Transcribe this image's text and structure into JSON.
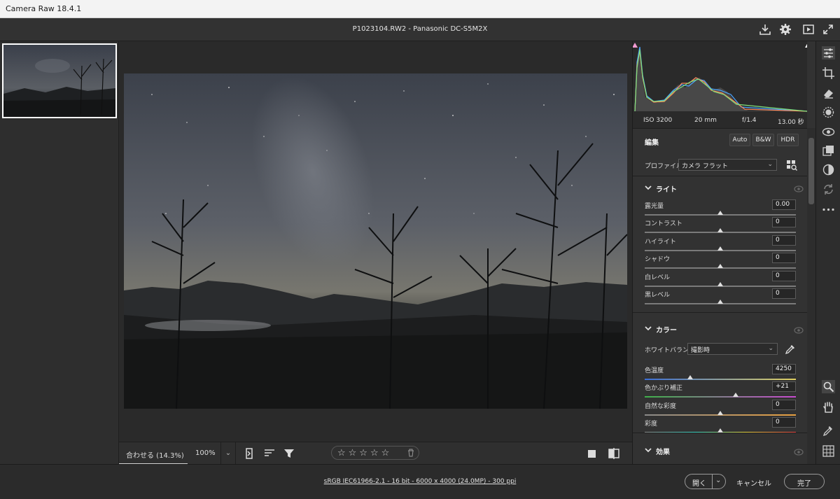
{
  "window": {
    "title": "Camera Raw 18.4.1"
  },
  "header": {
    "file_info": "P1023104.RW2  -  Panasonic DC-S5M2X"
  },
  "histogram": {
    "iso": "ISO 3200",
    "focal": "20 mm",
    "aperture": "f/1.4",
    "shutter": "13.00 秒"
  },
  "edit": {
    "title": "編集",
    "buttons": [
      "Auto",
      "B&W",
      "HDR"
    ],
    "profile_label": "プロファイル",
    "profile_value": "カメラ フラット"
  },
  "light": {
    "title": "ライト",
    "sliders": [
      {
        "name": "露光量",
        "value": "0.00",
        "pos": 0.5
      },
      {
        "name": "コントラスト",
        "value": "0",
        "pos": 0.5
      },
      {
        "name": "ハイライト",
        "value": "0",
        "pos": 0.5
      },
      {
        "name": "シャドウ",
        "value": "0",
        "pos": 0.5
      },
      {
        "name": "白レベル",
        "value": "0",
        "pos": 0.5
      },
      {
        "name": "黒レベル",
        "value": "0",
        "pos": 0.5
      }
    ]
  },
  "color": {
    "title": "カラー",
    "wb_label": "ホワイトバランス",
    "wb_value": "撮影時",
    "sliders": [
      {
        "name": "色温度",
        "value": "4250",
        "pos": 0.3
      },
      {
        "name": "色かぶり補正",
        "value": "+21",
        "pos": 0.6
      },
      {
        "name": "自然な彩度",
        "value": "0",
        "pos": 0.5
      },
      {
        "name": "彩度",
        "value": "0",
        "pos": 0.5
      }
    ]
  },
  "effects": {
    "title": "効果"
  },
  "viewer_bar": {
    "fit_label": "合わせる (14.3%)",
    "zoom_label": "100%",
    "stars": "☆☆☆☆☆"
  },
  "status": {
    "info": "sRGB IEC61966-2.1 - 16 bit - 6000 x 4000 (24.0MP) - 300 ppi"
  },
  "footer": {
    "open_label": "開く",
    "cancel_label": "キャンセル",
    "done_label": "完了"
  },
  "colors": {
    "accent_pink": "#f19ad2",
    "panel_bg": "#323232"
  }
}
